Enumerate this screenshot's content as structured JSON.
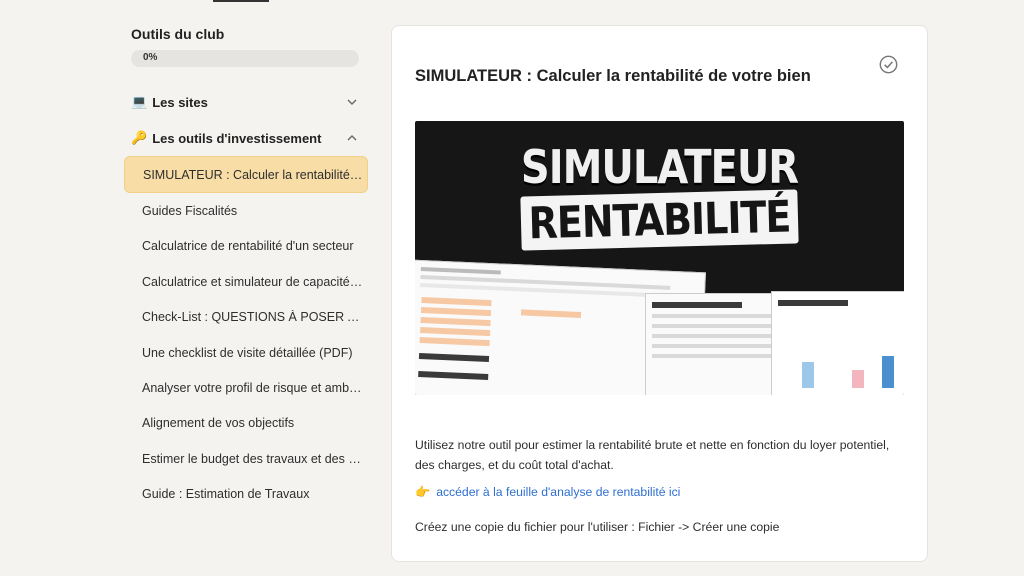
{
  "sidebar": {
    "title": "Outils du club",
    "progress": {
      "label": "0%",
      "value": 0
    },
    "sections": [
      {
        "icon": "laptop-icon",
        "emoji": "💻",
        "label": "Les sites",
        "expanded": false
      },
      {
        "icon": "key-icon",
        "emoji": "🔑",
        "label": "Les outils d'investissement",
        "expanded": true
      }
    ],
    "lessons": [
      "SIMULATEUR : Calculer la rentabilité de votre bien",
      "Guides Fiscalités",
      "Calculatrice de rentabilité d'un secteur",
      "Calculatrice et simulateur de capacité d'emprunt",
      "Check-List : QUESTIONS À POSER AUX VENDEURS",
      "Une checklist de visite détaillée (PDF)",
      "Analyser votre profil de risque et ambition",
      "Alignement de vos objectifs",
      "Estimer le budget des travaux et des coûts",
      "Guide : Estimation de Travaux"
    ],
    "active_index": 0
  },
  "main": {
    "title": "SIMULATEUR : Calculer la rentabilité de votre bien",
    "hero": {
      "line1": "SIMULATEUR",
      "line2": "RENTABILITÉ"
    },
    "description": "Utilisez notre outil pour estimer la rentabilité brute et nette en fonction du loyer potentiel, des charges, et du coût total d'achat.",
    "link": {
      "emoji": "👉",
      "label": "accéder à la feuille d'analyse de rentabilité ici"
    },
    "copy_instruction": "Créez une copie du fichier pour l'utiliser : Fichier -> Créer une copie"
  },
  "colors": {
    "accent": "#f8dea6",
    "link": "#2f6fd0",
    "progress": "#f4d48a"
  }
}
